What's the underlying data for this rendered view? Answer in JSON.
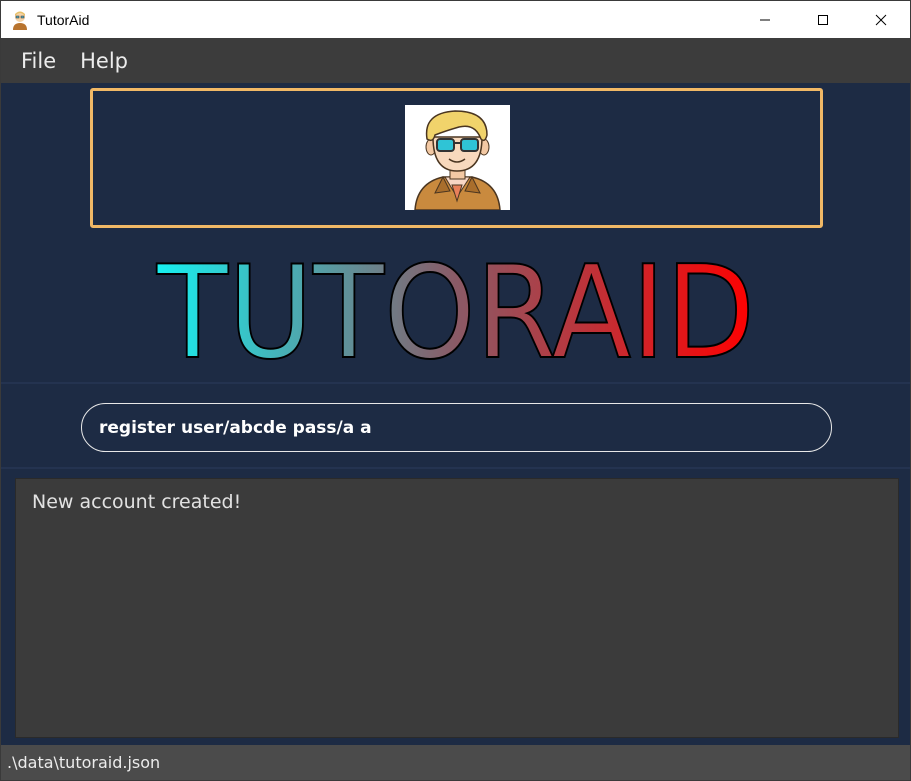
{
  "window": {
    "title": "TutorAid"
  },
  "menu": {
    "items": [
      {
        "label": "File"
      },
      {
        "label": "Help"
      }
    ]
  },
  "logo": {
    "title": "TUTORAID",
    "avatar_icon": "tutor-avatar-icon",
    "frame_color": "#f0b866",
    "gradient_start": "#16f0f0",
    "gradient_end": "#ff0000"
  },
  "command": {
    "value": "register user/abcde pass/a a"
  },
  "result": {
    "message": "New account created!"
  },
  "status": {
    "path": ".\\data\\tutoraid.json"
  },
  "colors": {
    "background": "#1d2b44",
    "menubar": "#3c3c3c",
    "result_bg": "#3b3b3b",
    "statusbar": "#4b4b4b"
  }
}
